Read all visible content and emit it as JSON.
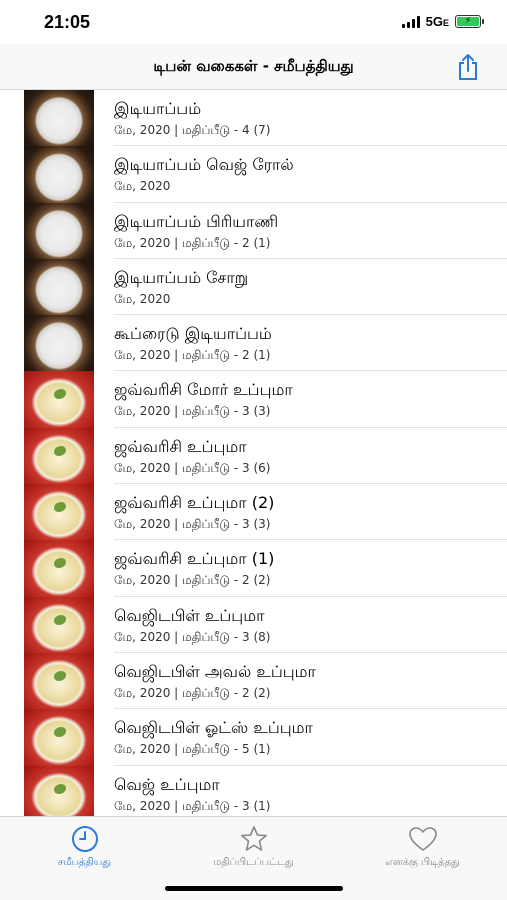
{
  "status": {
    "time": "21:05",
    "network": "5G",
    "network_suffix": "E"
  },
  "nav": {
    "title": "டிபன் வகைகள்  - சமீபத்தியது"
  },
  "items": [
    {
      "title": "இடியாப்பம்",
      "subtitle": "மே, 2020 | மதிப்பீடு - 4 (7)",
      "thumb": "rice"
    },
    {
      "title": "இடியாப்பம் வெஜ் ரோல்",
      "subtitle": "மே, 2020",
      "thumb": "rice"
    },
    {
      "title": "இடியாப்பம் பிரியாணி",
      "subtitle": "மே, 2020 | மதிப்பீடு - 2 (1)",
      "thumb": "rice"
    },
    {
      "title": "இடியாப்பம் சோறு",
      "subtitle": "மே, 2020",
      "thumb": "rice"
    },
    {
      "title": "கூப்ரைடு இடியாப்பம்",
      "subtitle": "மே, 2020 | மதிப்பீடு - 2 (1)",
      "thumb": "rice"
    },
    {
      "title": "ஜவ்வரிசி மோர் உப்புமா",
      "subtitle": "மே, 2020 | மதிப்பீடு - 3 (3)",
      "thumb": "upma"
    },
    {
      "title": "ஜவ்வரிசி உப்புமா",
      "subtitle": "மே, 2020 | மதிப்பீடு - 3 (6)",
      "thumb": "upma"
    },
    {
      "title": "ஜவ்வரிசி உப்புமா (2)",
      "subtitle": "மே, 2020 | மதிப்பீடு - 3 (3)",
      "thumb": "upma"
    },
    {
      "title": "ஜவ்வரிசி உப்புமா (1)",
      "subtitle": "மே, 2020 | மதிப்பீடு - 2 (2)",
      "thumb": "upma"
    },
    {
      "title": "வெஜிடபிள் உப்புமா",
      "subtitle": "மே, 2020 | மதிப்பீடு - 3 (8)",
      "thumb": "upma"
    },
    {
      "title": "வெஜிடபிள் அவல் உப்புமா",
      "subtitle": "மே, 2020 | மதிப்பீடு - 2 (2)",
      "thumb": "upma"
    },
    {
      "title": "வெஜிடபிள்  ஓட்ஸ் உப்புமா",
      "subtitle": "மே, 2020 | மதிப்பீடு - 5 (1)",
      "thumb": "upma"
    },
    {
      "title": "வெஜ் உப்புமா",
      "subtitle": "மே, 2020 | மதிப்பீடு - 3 (1)",
      "thumb": "upma"
    }
  ],
  "tabs": [
    {
      "label": "சமீபத்தியது",
      "icon": "clock-icon",
      "active": true
    },
    {
      "label": "மதிப்பிடப்பட்டது",
      "icon": "star-icon",
      "active": false
    },
    {
      "label": "எனக்கு பிடித்தது",
      "icon": "heart-icon",
      "active": false
    }
  ],
  "colors": {
    "accent": "#2e7bd6",
    "inactive": "#888888"
  }
}
